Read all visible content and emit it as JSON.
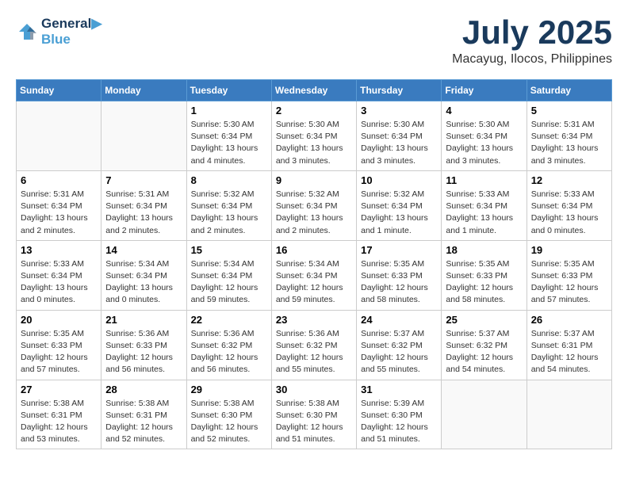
{
  "header": {
    "logo_line1": "General",
    "logo_line2": "Blue",
    "month": "July 2025",
    "location": "Macayug, Ilocos, Philippines"
  },
  "weekdays": [
    "Sunday",
    "Monday",
    "Tuesday",
    "Wednesday",
    "Thursday",
    "Friday",
    "Saturday"
  ],
  "weeks": [
    [
      {
        "day": "",
        "info": ""
      },
      {
        "day": "",
        "info": ""
      },
      {
        "day": "1",
        "info": "Sunrise: 5:30 AM\nSunset: 6:34 PM\nDaylight: 13 hours and 4 minutes."
      },
      {
        "day": "2",
        "info": "Sunrise: 5:30 AM\nSunset: 6:34 PM\nDaylight: 13 hours and 3 minutes."
      },
      {
        "day": "3",
        "info": "Sunrise: 5:30 AM\nSunset: 6:34 PM\nDaylight: 13 hours and 3 minutes."
      },
      {
        "day": "4",
        "info": "Sunrise: 5:30 AM\nSunset: 6:34 PM\nDaylight: 13 hours and 3 minutes."
      },
      {
        "day": "5",
        "info": "Sunrise: 5:31 AM\nSunset: 6:34 PM\nDaylight: 13 hours and 3 minutes."
      }
    ],
    [
      {
        "day": "6",
        "info": "Sunrise: 5:31 AM\nSunset: 6:34 PM\nDaylight: 13 hours and 2 minutes."
      },
      {
        "day": "7",
        "info": "Sunrise: 5:31 AM\nSunset: 6:34 PM\nDaylight: 13 hours and 2 minutes."
      },
      {
        "day": "8",
        "info": "Sunrise: 5:32 AM\nSunset: 6:34 PM\nDaylight: 13 hours and 2 minutes."
      },
      {
        "day": "9",
        "info": "Sunrise: 5:32 AM\nSunset: 6:34 PM\nDaylight: 13 hours and 2 minutes."
      },
      {
        "day": "10",
        "info": "Sunrise: 5:32 AM\nSunset: 6:34 PM\nDaylight: 13 hours and 1 minute."
      },
      {
        "day": "11",
        "info": "Sunrise: 5:33 AM\nSunset: 6:34 PM\nDaylight: 13 hours and 1 minute."
      },
      {
        "day": "12",
        "info": "Sunrise: 5:33 AM\nSunset: 6:34 PM\nDaylight: 13 hours and 0 minutes."
      }
    ],
    [
      {
        "day": "13",
        "info": "Sunrise: 5:33 AM\nSunset: 6:34 PM\nDaylight: 13 hours and 0 minutes."
      },
      {
        "day": "14",
        "info": "Sunrise: 5:34 AM\nSunset: 6:34 PM\nDaylight: 13 hours and 0 minutes."
      },
      {
        "day": "15",
        "info": "Sunrise: 5:34 AM\nSunset: 6:34 PM\nDaylight: 12 hours and 59 minutes."
      },
      {
        "day": "16",
        "info": "Sunrise: 5:34 AM\nSunset: 6:34 PM\nDaylight: 12 hours and 59 minutes."
      },
      {
        "day": "17",
        "info": "Sunrise: 5:35 AM\nSunset: 6:33 PM\nDaylight: 12 hours and 58 minutes."
      },
      {
        "day": "18",
        "info": "Sunrise: 5:35 AM\nSunset: 6:33 PM\nDaylight: 12 hours and 58 minutes."
      },
      {
        "day": "19",
        "info": "Sunrise: 5:35 AM\nSunset: 6:33 PM\nDaylight: 12 hours and 57 minutes."
      }
    ],
    [
      {
        "day": "20",
        "info": "Sunrise: 5:35 AM\nSunset: 6:33 PM\nDaylight: 12 hours and 57 minutes."
      },
      {
        "day": "21",
        "info": "Sunrise: 5:36 AM\nSunset: 6:33 PM\nDaylight: 12 hours and 56 minutes."
      },
      {
        "day": "22",
        "info": "Sunrise: 5:36 AM\nSunset: 6:32 PM\nDaylight: 12 hours and 56 minutes."
      },
      {
        "day": "23",
        "info": "Sunrise: 5:36 AM\nSunset: 6:32 PM\nDaylight: 12 hours and 55 minutes."
      },
      {
        "day": "24",
        "info": "Sunrise: 5:37 AM\nSunset: 6:32 PM\nDaylight: 12 hours and 55 minutes."
      },
      {
        "day": "25",
        "info": "Sunrise: 5:37 AM\nSunset: 6:32 PM\nDaylight: 12 hours and 54 minutes."
      },
      {
        "day": "26",
        "info": "Sunrise: 5:37 AM\nSunset: 6:31 PM\nDaylight: 12 hours and 54 minutes."
      }
    ],
    [
      {
        "day": "27",
        "info": "Sunrise: 5:38 AM\nSunset: 6:31 PM\nDaylight: 12 hours and 53 minutes."
      },
      {
        "day": "28",
        "info": "Sunrise: 5:38 AM\nSunset: 6:31 PM\nDaylight: 12 hours and 52 minutes."
      },
      {
        "day": "29",
        "info": "Sunrise: 5:38 AM\nSunset: 6:30 PM\nDaylight: 12 hours and 52 minutes."
      },
      {
        "day": "30",
        "info": "Sunrise: 5:38 AM\nSunset: 6:30 PM\nDaylight: 12 hours and 51 minutes."
      },
      {
        "day": "31",
        "info": "Sunrise: 5:39 AM\nSunset: 6:30 PM\nDaylight: 12 hours and 51 minutes."
      },
      {
        "day": "",
        "info": ""
      },
      {
        "day": "",
        "info": ""
      }
    ]
  ]
}
